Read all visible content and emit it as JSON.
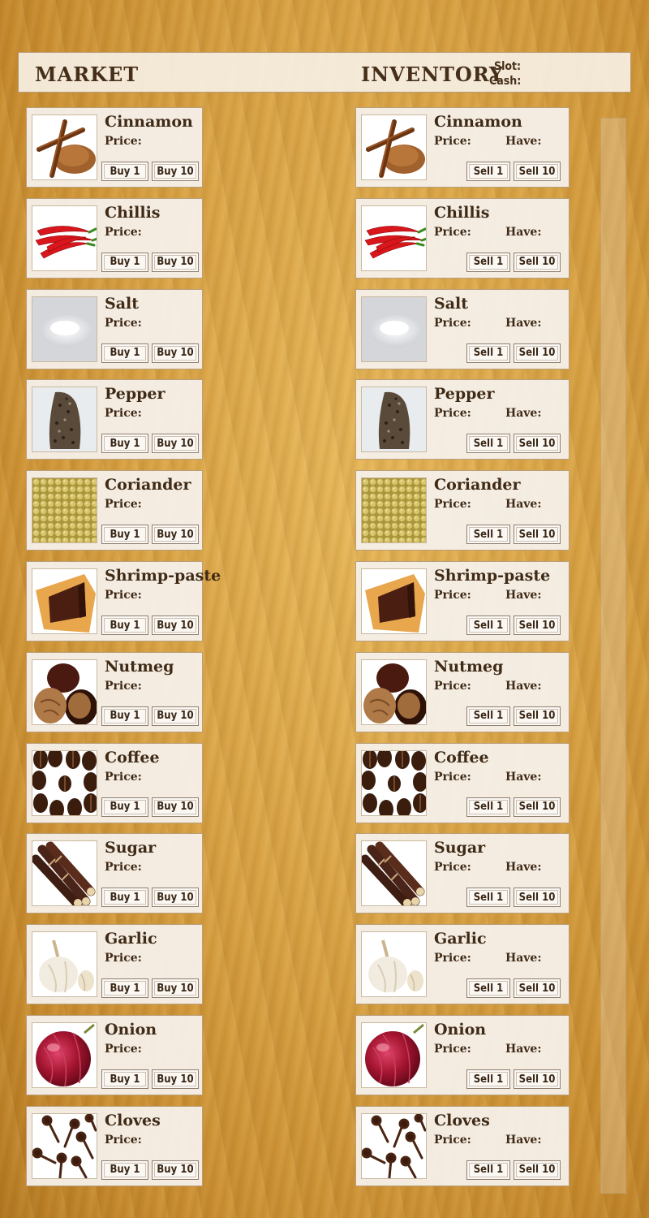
{
  "market": {
    "title": "MARKET"
  },
  "inventory": {
    "title": "INVENTORY",
    "slot_label": "Slot:",
    "cash_label": "Cash:"
  },
  "labels": {
    "price": "Price:",
    "have": "Have:",
    "buy1": "Buy 1",
    "buy10": "Buy 10",
    "sell1": "Sell 1",
    "sell10": "Sell 10"
  },
  "items": [
    {
      "name": "Cinnamon",
      "icon": "cinnamon-icon"
    },
    {
      "name": "Chillis",
      "icon": "chilli-icon"
    },
    {
      "name": "Salt",
      "icon": "salt-icon"
    },
    {
      "name": "Pepper",
      "icon": "pepper-icon"
    },
    {
      "name": "Coriander",
      "icon": "coriander-icon"
    },
    {
      "name": "Shrimp-paste",
      "icon": "shrimp-paste-icon"
    },
    {
      "name": "Nutmeg",
      "icon": "nutmeg-icon"
    },
    {
      "name": "Coffee",
      "icon": "coffee-icon"
    },
    {
      "name": "Sugar",
      "icon": "sugarcane-icon"
    },
    {
      "name": "Garlic",
      "icon": "garlic-icon"
    },
    {
      "name": "Onion",
      "icon": "onion-icon"
    },
    {
      "name": "Cloves",
      "icon": "cloves-icon"
    }
  ],
  "colors": {
    "text": "#3f2a16",
    "card_bg": "#f6f0ea",
    "wood": "#d9a243"
  }
}
